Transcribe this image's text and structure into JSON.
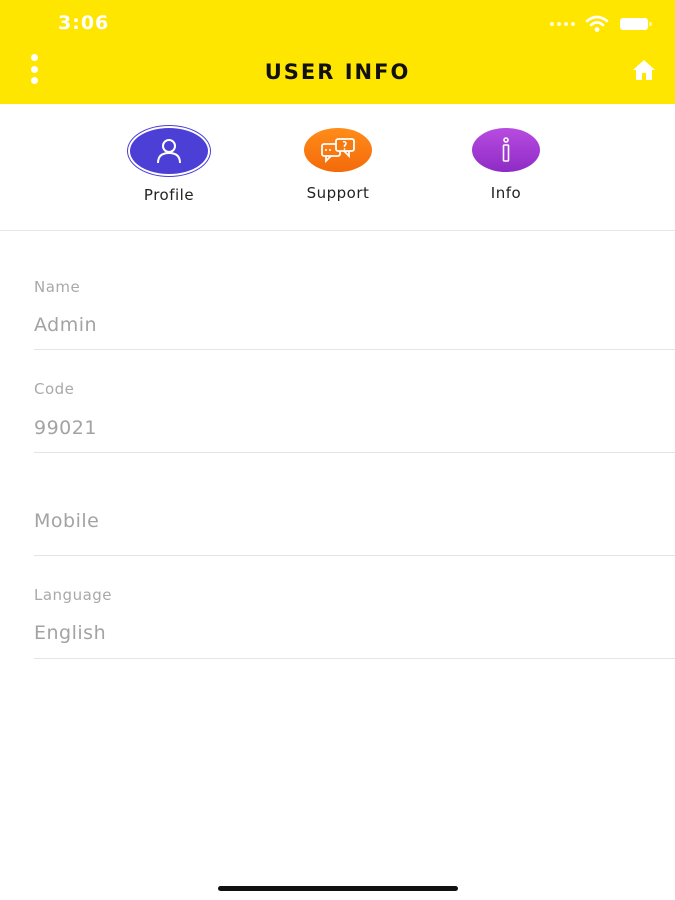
{
  "status_bar": {
    "time": "3:06"
  },
  "header": {
    "title": "USER INFO",
    "menu_icon": "vertical-dots-icon",
    "home_icon": "home-icon",
    "background": "#FFE600"
  },
  "tabs": [
    {
      "label": "Profile",
      "icon": "user-icon",
      "color": "#4B3FD6"
    },
    {
      "label": "Support",
      "icon": "chat-support-icon",
      "color": "#F47A12"
    },
    {
      "label": "Info",
      "icon": "info-icon",
      "color": "#A23DD6"
    }
  ],
  "form": {
    "name": {
      "label": "Name",
      "value": "Admin"
    },
    "code": {
      "label": "Code",
      "value": "99021"
    },
    "mobile": {
      "placeholder": "Mobile"
    },
    "language": {
      "label": "Language",
      "value": "English"
    }
  }
}
